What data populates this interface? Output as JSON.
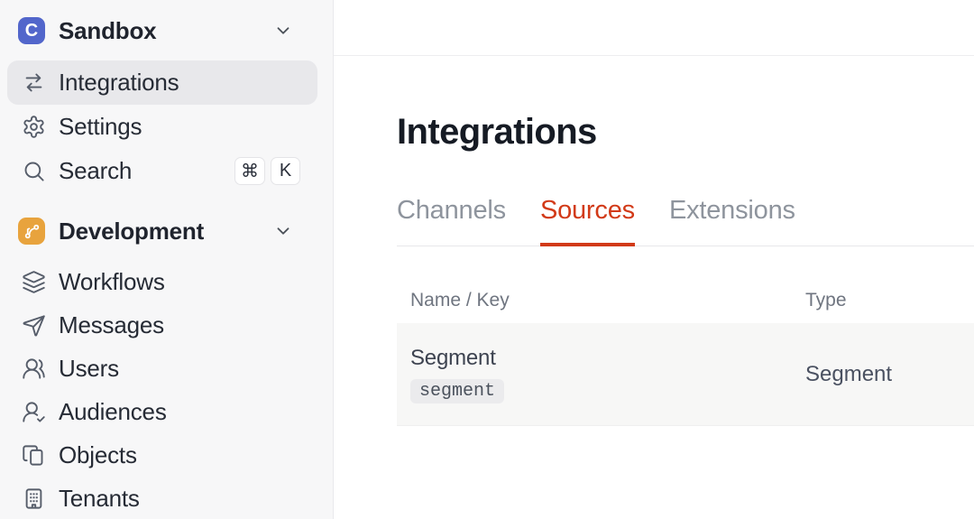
{
  "colors": {
    "accent_red": "#D23A18",
    "logo_indigo": "#5266CB",
    "dev_orange": "#E8A33D",
    "sidebar_bg": "#F7F7F8",
    "active_item_bg": "#E8E8EB",
    "row_bg": "#F7F7F6"
  },
  "sidebar": {
    "workspace": {
      "initial": "C",
      "name": "Sandbox"
    },
    "items": [
      {
        "label": "Integrations"
      },
      {
        "label": "Settings"
      },
      {
        "label": "Search"
      }
    ],
    "search_shortcut": {
      "mod": "⌘",
      "key": "K"
    },
    "section": {
      "label": "Development"
    },
    "dev_items": [
      {
        "label": "Workflows"
      },
      {
        "label": "Messages"
      },
      {
        "label": "Users"
      },
      {
        "label": "Audiences"
      },
      {
        "label": "Objects"
      },
      {
        "label": "Tenants"
      }
    ]
  },
  "main": {
    "title": "Integrations",
    "tabs": [
      {
        "label": "Channels"
      },
      {
        "label": "Sources"
      },
      {
        "label": "Extensions"
      }
    ],
    "table": {
      "columns": [
        "Name / Key",
        "Type"
      ],
      "rows": [
        {
          "name": "Segment",
          "key": "segment",
          "type": "Segment"
        }
      ]
    }
  }
}
